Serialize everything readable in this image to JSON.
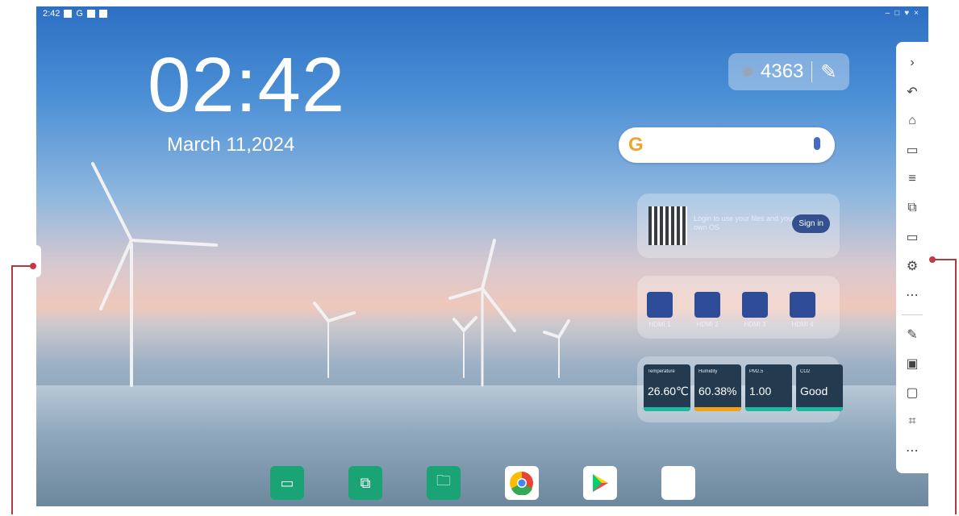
{
  "status": {
    "time": "2:42",
    "google_letter": "G"
  },
  "home": {
    "clock": "02:42",
    "date": "March 11,2024"
  },
  "counter": {
    "value": "4363"
  },
  "search": {
    "g_label": "G"
  },
  "login": {
    "text": "Login to use your files and your own OS",
    "signin": "Sign in"
  },
  "hdmi": {
    "items": [
      "HDMI 1",
      "HDMI 2",
      "HDMI 3",
      "HDMI 4"
    ]
  },
  "sensors": [
    {
      "label": "Temperature",
      "value": "26.60℃",
      "color": "#1db89d"
    },
    {
      "label": "Humidity",
      "value": "60.38%",
      "color": "#f2a218"
    },
    {
      "label": "PM2.5",
      "value": "1.00",
      "color": "#1db89d"
    },
    {
      "label": "CO2",
      "value": "Good",
      "color": "#1db89d"
    }
  ],
  "dock": {
    "apps": [
      "display-app",
      "cast-app",
      "files-app",
      "chrome-app",
      "play-store-app",
      "google-apps-folder"
    ]
  },
  "sidebar": {
    "icons": [
      "chevron-right-icon",
      "undo-icon",
      "home-icon",
      "recent-apps-icon",
      "menu-icon",
      "cast-icon",
      "display-icon",
      "settings-icon",
      "apps-icon",
      "pen-icon",
      "hdmi-input-icon",
      "screen-record-icon",
      "crop-icon",
      "more-icon"
    ]
  }
}
